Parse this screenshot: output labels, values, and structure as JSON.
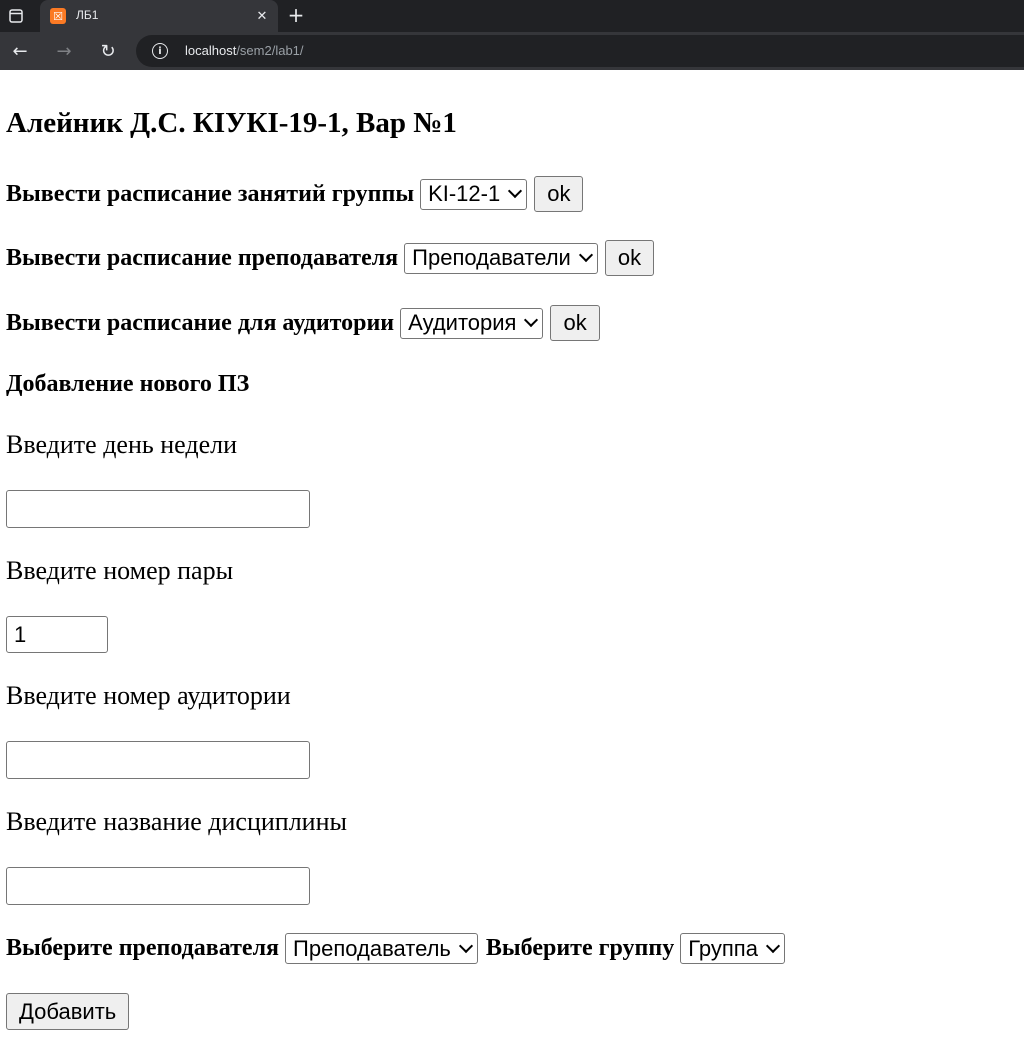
{
  "browser": {
    "tab_title": "ЛБ1",
    "url_host": "localhost",
    "url_path": "/sem2/lab1/"
  },
  "page": {
    "heading": "Алейник Д.С. КІУКІ-19-1, Вар №1",
    "group_schedule": {
      "label": "Вывести расписание занятий группы",
      "selected": "KI-12-1",
      "button": "ok"
    },
    "teacher_schedule": {
      "label": "Вывести расписание преподавателя",
      "selected": "Преподаватели",
      "button": "ok"
    },
    "room_schedule": {
      "label": "Вывести расписание для аудитории",
      "selected": "Аудитория",
      "button": "ok"
    },
    "add_section": {
      "heading": "Добавление нового ПЗ",
      "day_label": "Введите день недели",
      "day_value": "",
      "pair_label": "Введите номер пары",
      "pair_value": "1",
      "room_label": "Введите номер аудитории",
      "room_value": "",
      "discipline_label": "Введите название дисциплины",
      "discipline_value": "",
      "teacher_label": "Выберите преподавателя",
      "teacher_selected": "Преподаватель",
      "group_label": "Выберите группу",
      "group_selected": "Группа",
      "submit": "Добавить"
    }
  }
}
